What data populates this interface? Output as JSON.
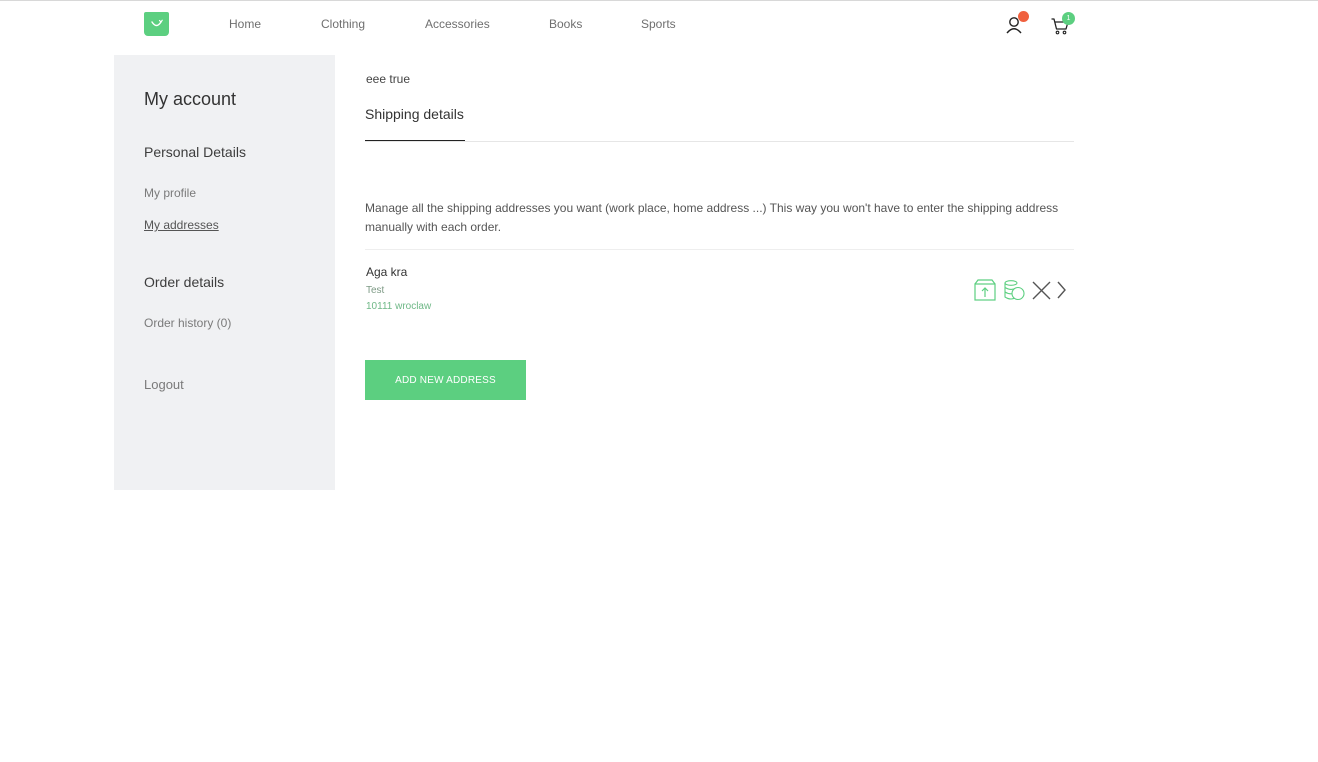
{
  "colors": {
    "brand_green": "#5ccf80",
    "user_badge": "#f0613f",
    "sidebar_bg": "#f0f1f3"
  },
  "header": {
    "logo_icon": "shopping-bag-icon",
    "nav": [
      "Home",
      "Clothing",
      "Accessories",
      "Books",
      "Sports"
    ],
    "user_icon": "user-icon",
    "cart_icon": "cart-icon",
    "cart_count": "1"
  },
  "sidebar": {
    "title": "My account",
    "personal_heading": "Personal Details",
    "my_profile": "My profile",
    "my_addresses": "My addresses",
    "order_heading": "Order details",
    "order_history": "Order history (0)",
    "logout": "Logout"
  },
  "main": {
    "greeting": "eee true",
    "tab": "Shipping details",
    "description": "Manage all the shipping addresses you want (work place, home address ...) This way you won't have to enter the shipping address manually with each order.",
    "address": {
      "name": "Aga kra",
      "line1": "Test",
      "line2": "10111 wroclaw",
      "actions": [
        "default-shipping-box-icon",
        "default-billing-coins-icon",
        "delete-x-icon",
        "chevron-right-icon"
      ]
    },
    "add_button": "ADD NEW ADDRESS"
  }
}
